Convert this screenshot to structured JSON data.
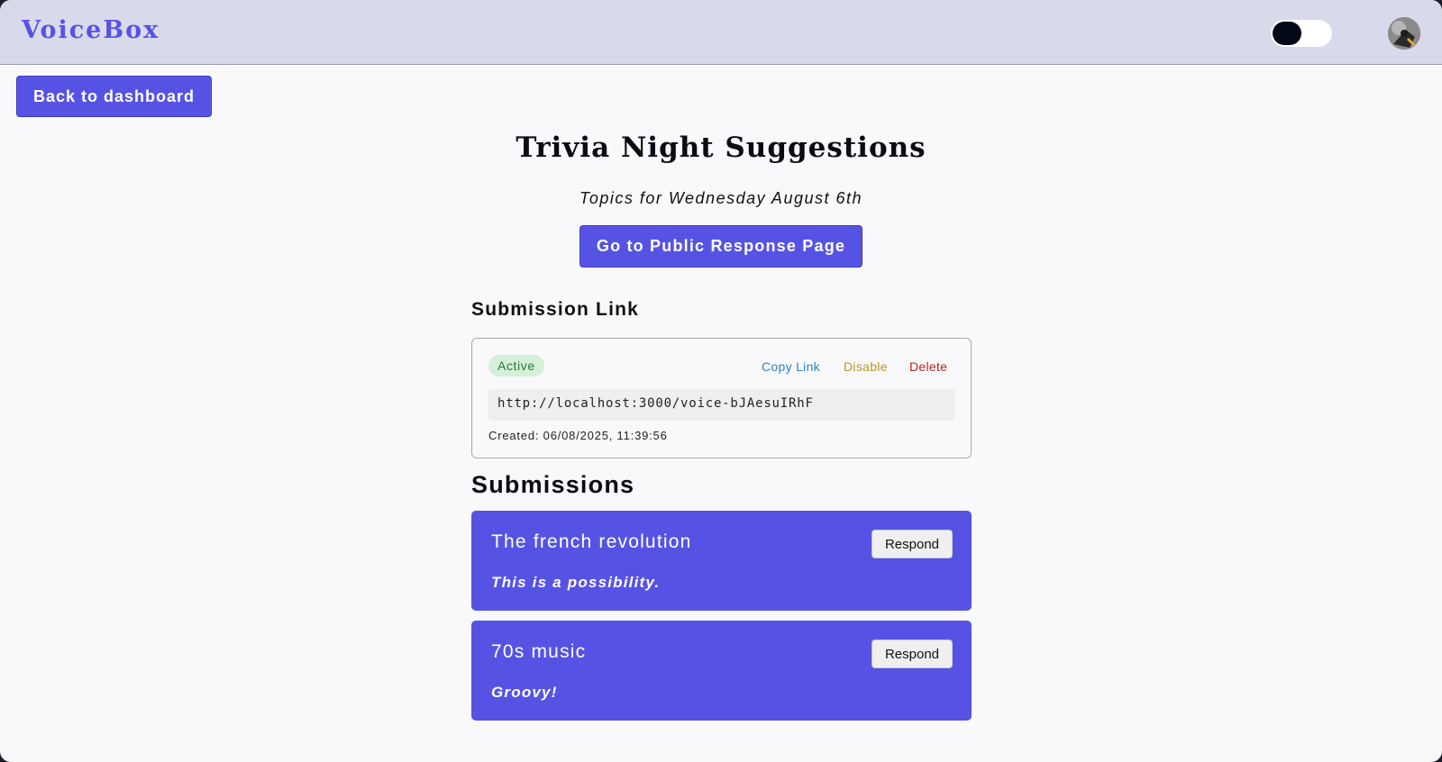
{
  "header": {
    "brand": "VoiceBox",
    "theme_toggle_state": "dark-off",
    "avatar_icon": "user-avatar"
  },
  "nav": {
    "back_label": "Back to dashboard"
  },
  "page": {
    "title": "Trivia Night Suggestions",
    "subtitle": "Topics for Wednesday August 6th",
    "public_button_label": "Go to Public Response Page"
  },
  "submission_link": {
    "heading": "Submission Link",
    "status": "Active",
    "actions": {
      "copy": "Copy Link",
      "disable": "Disable",
      "delete": "Delete"
    },
    "url": "http://localhost:3000/voice-bJAesuIRhF",
    "created": "Created: 06/08/2025, 11:39:56"
  },
  "submissions": {
    "heading": "Submissions",
    "items": [
      {
        "title": "The french revolution",
        "note": "This is a possibility.",
        "respond_label": "Respond"
      },
      {
        "title": "70s music",
        "note": "Groovy!",
        "respond_label": "Respond"
      }
    ]
  },
  "colors": {
    "accent": "#5653e4",
    "header_bg": "#d9d9ec",
    "page_bg": "#f9f9fb",
    "status_active_bg": "#d4f0d8",
    "status_active_text": "#257a3a",
    "copy_link": "#2e86c1",
    "disable": "#b79a26",
    "delete": "#b3261e"
  }
}
